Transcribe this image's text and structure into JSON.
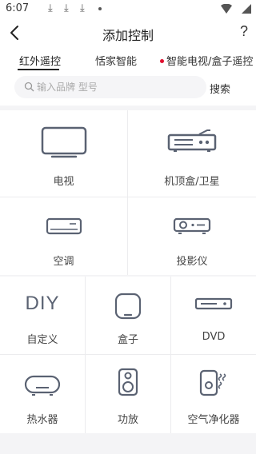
{
  "status": {
    "time": "6:07"
  },
  "header": {
    "title": "添加控制",
    "help": "?"
  },
  "tabs": [
    {
      "label": "红外遥控",
      "active": true
    },
    {
      "label": "恬家智能",
      "active": false
    },
    {
      "label": "智能电视/盒子遥控",
      "active": false,
      "badge": true
    }
  ],
  "search": {
    "placeholder": "输入品牌 型号",
    "button": "搜索"
  },
  "devices": [
    {
      "label": "电视",
      "icon": "tv-icon"
    },
    {
      "label": "机顶盒/卫星",
      "icon": "set-top-box-icon"
    },
    {
      "label": "空调",
      "icon": "air-conditioner-icon"
    },
    {
      "label": "投影仪",
      "icon": "projector-icon"
    },
    {
      "label": "自定义",
      "icon": "diy-icon",
      "icon_text": "DIY"
    },
    {
      "label": "盒子",
      "icon": "box-icon"
    },
    {
      "label": "DVD",
      "icon": "dvd-icon"
    },
    {
      "label": "热水器",
      "icon": "water-heater-icon"
    },
    {
      "label": "功放",
      "icon": "amplifier-icon"
    },
    {
      "label": "空气净化器",
      "icon": "air-purifier-icon"
    }
  ]
}
